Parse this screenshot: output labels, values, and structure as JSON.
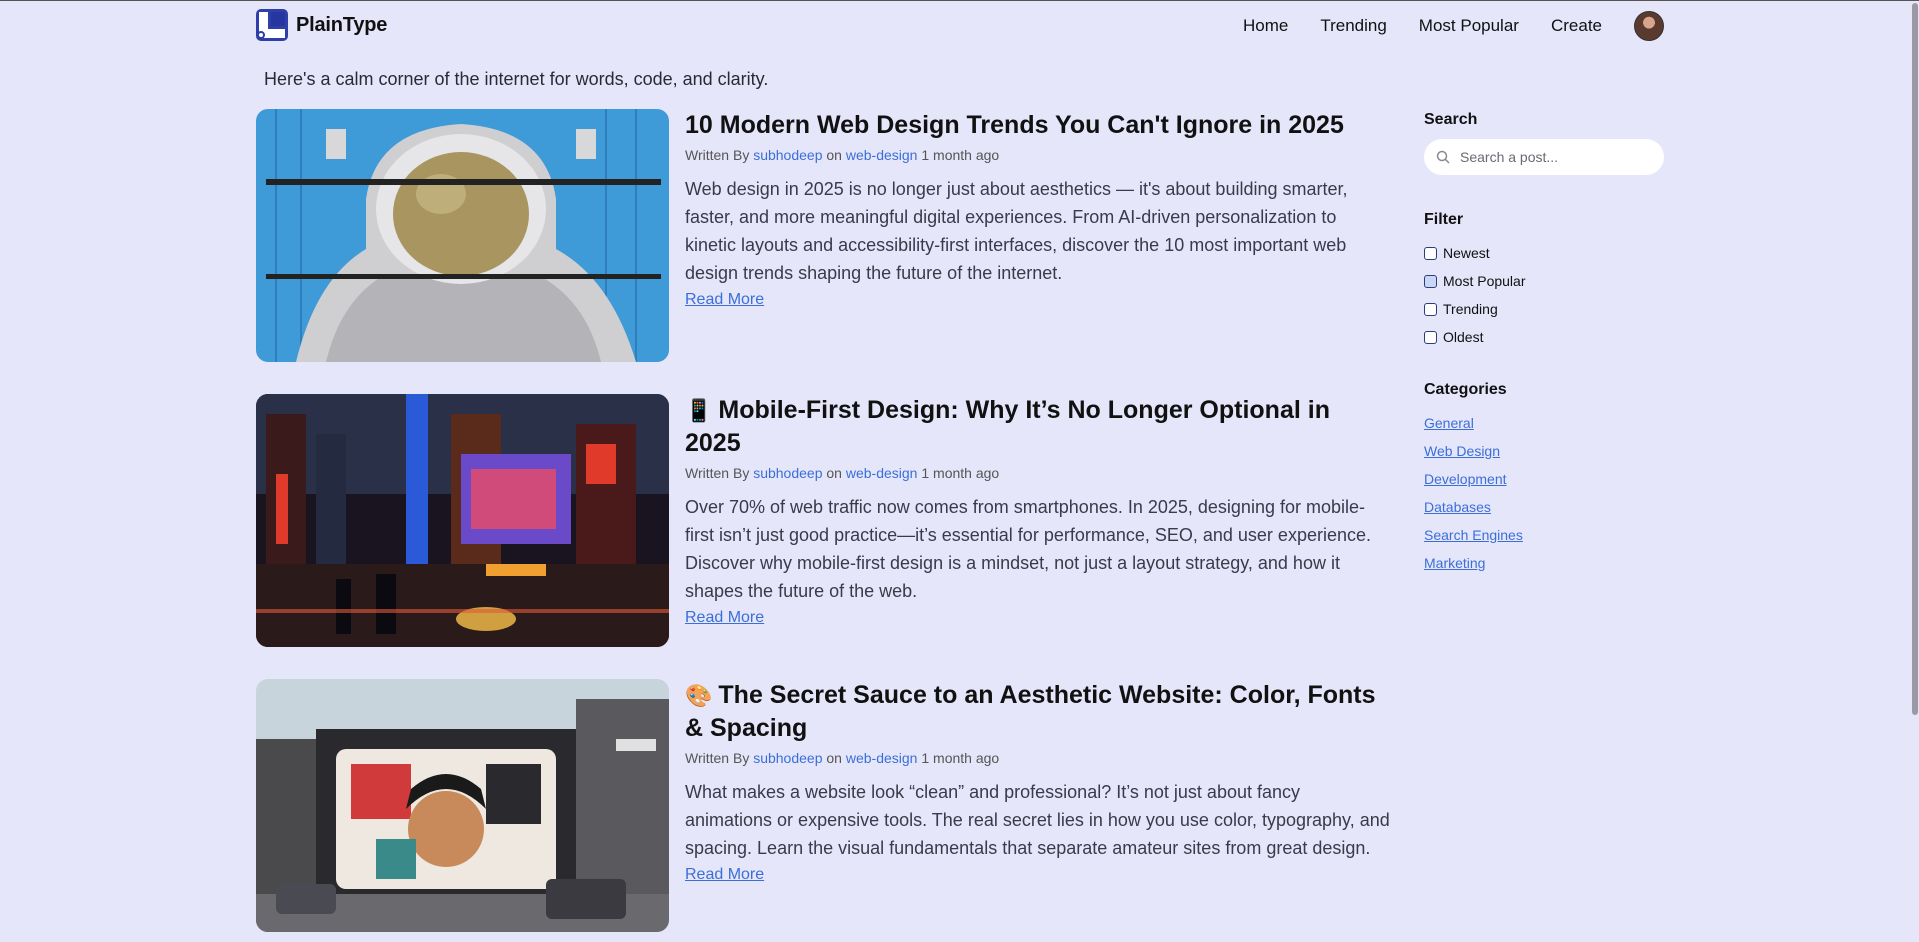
{
  "brand": {
    "name": "PlainType"
  },
  "nav": {
    "items": [
      "Home",
      "Trending",
      "Most Popular",
      "Create"
    ]
  },
  "tagline": "Here's a calm corner of the internet for words, code, and clarity.",
  "posts": [
    {
      "emoji": "",
      "title": "10 Modern Web Design Trends You Can't Ignore in 2025",
      "meta_prefix": "Written By",
      "author": "subhodeep",
      "meta_on": "on",
      "category": "web-design",
      "time": "1 month ago",
      "excerpt": "Web design in 2025 is no longer just about aesthetics — it's about building smarter, faster, and more meaningful digital experiences. From AI-driven personalization to kinetic layouts and accessibility-first interfaces, discover the 10 most important web design trends shaping the future of the internet.",
      "read_more": "Read More",
      "image": "astronaut-mural"
    },
    {
      "emoji": "📱",
      "title": "Mobile-First Design: Why It’s No Longer Optional in 2025",
      "meta_prefix": "Written By",
      "author": "subhodeep",
      "meta_on": "on",
      "category": "web-design",
      "time": "1 month ago",
      "excerpt": "Over 70% of web traffic now comes from smartphones. In 2025, designing for mobile-first isn’t just good practice—it’s essential for performance, SEO, and user experience. Discover why mobile-first design is a mindset, not just a layout strategy, and how it shapes the future of the web.",
      "read_more": "Read More",
      "image": "city-night-street"
    },
    {
      "emoji": "🎨",
      "title": "The Secret Sauce to an Aesthetic Website: Color, Fonts & Spacing",
      "meta_prefix": "Written By",
      "author": "subhodeep",
      "meta_on": "on",
      "category": "web-design",
      "time": "1 month ago",
      "excerpt": "What makes a website look “clean” and professional? It’s not just about fancy animations or expensive tools. The real secret lies in how you use color, typography, and spacing. Learn the visual fundamentals that separate amateur sites from great design.",
      "read_more": "Read More",
      "image": "street-mural"
    }
  ],
  "sidebar": {
    "search_title": "Search",
    "search_placeholder": "Search a post...",
    "filter_title": "Filter",
    "filters": [
      "Newest",
      "Most Popular",
      "Trending",
      "Oldest"
    ],
    "categories_title": "Categories",
    "categories": [
      "General",
      "Web Design",
      "Development",
      "Databases",
      "Search Engines",
      "Marketing"
    ]
  },
  "colors": {
    "background": "#e6e6fb",
    "link": "#3a6fd8",
    "brand": "#2f3fa8"
  }
}
